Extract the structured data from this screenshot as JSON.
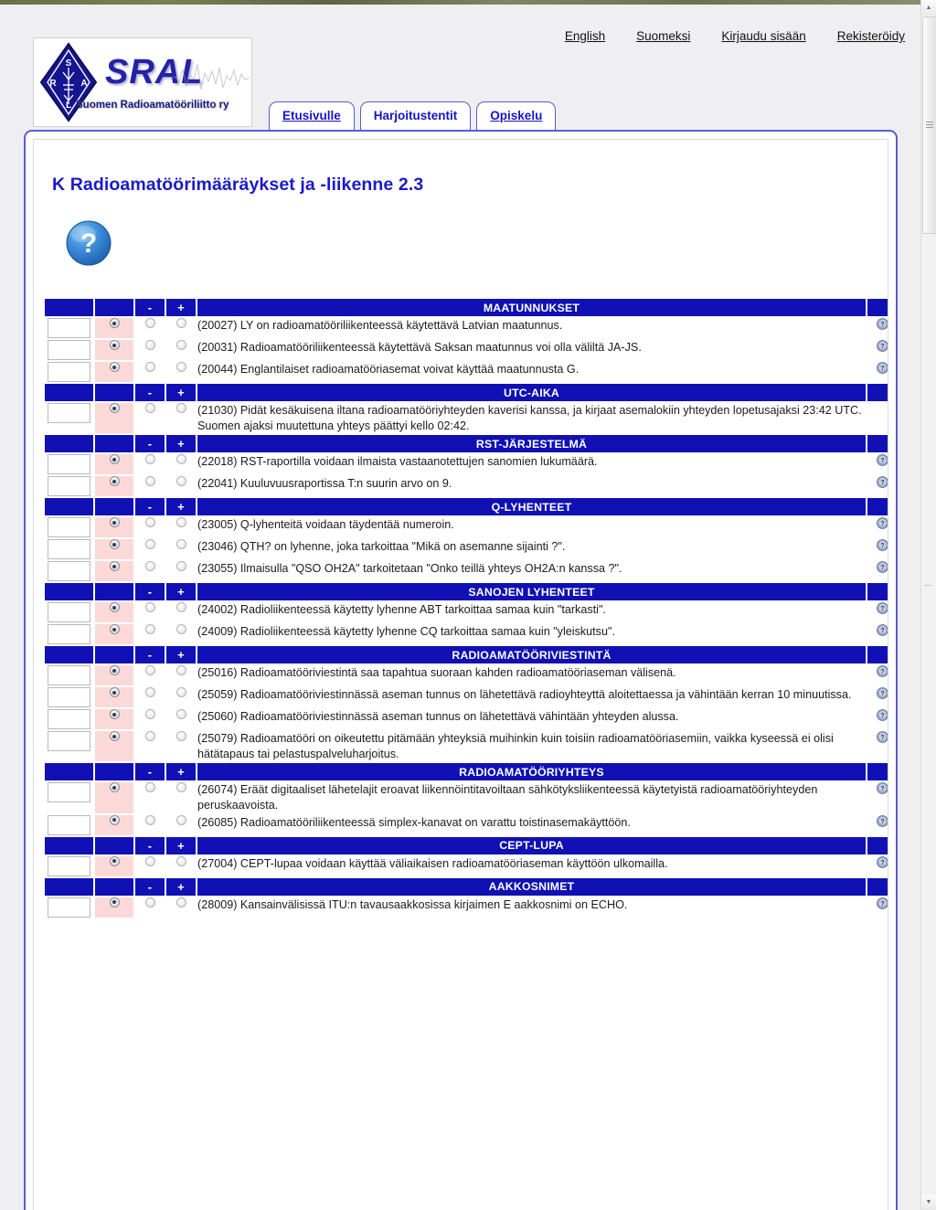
{
  "top_nav": {
    "links": [
      {
        "label": "English",
        "name": "nav-link-english"
      },
      {
        "label": "Suomeksi",
        "name": "nav-link-suomeksi"
      },
      {
        "label": "Kirjaudu sisään",
        "name": "nav-link-login"
      },
      {
        "label": "Rekisteröidy",
        "name": "nav-link-register"
      }
    ]
  },
  "logo": {
    "lettermark": "SRAL",
    "subtitle": "Suomen Radioamatööriliitto ry",
    "diamond_letters": [
      "S",
      "R",
      "A",
      "L"
    ],
    "colors": {
      "mark": "#2222aa",
      "diamond": "#15158f"
    }
  },
  "tabs": [
    {
      "label": "Etusivulle",
      "active": false
    },
    {
      "label": "Harjoitustentit",
      "active": true
    },
    {
      "label": "Opiskelu",
      "active": false
    }
  ],
  "page": {
    "title": "K Radioamatöörimääräykset ja -liikenne 2.3",
    "help_icon": "question-mark-icon"
  },
  "table": {
    "header_minus": "-",
    "header_plus": "+",
    "row_help_icon": "question-mark-icon",
    "colors": {
      "header_bg": "#1010b4",
      "selected_cell_bg": "#fbd9d9",
      "title_blue": "#1a1aca"
    },
    "sections": [
      {
        "title": "MAATUNNUKSET",
        "questions": [
          {
            "id": "20027",
            "text": "(20027) LY on radioamatööriliikenteessä käytettävä Latvian maatunnus.",
            "selected": "blank",
            "answer_value": ""
          },
          {
            "id": "20031",
            "text": "(20031) Radioamatööriliikenteessä käytettävä Saksan maatunnus voi olla väliltä JA-JS.",
            "selected": "blank",
            "answer_value": ""
          },
          {
            "id": "20044",
            "text": "(20044) Englantilaiset radioamatööriasemat voivat käyttää maatunnusta G.",
            "selected": "blank",
            "answer_value": ""
          }
        ]
      },
      {
        "title": "UTC-AIKA",
        "questions": [
          {
            "id": "21030",
            "text": "(21030) Pidät kesäkuisena iltana radioamatööriyhteyden kaverisi kanssa, ja kirjaat asemalokiin yhteyden lopetusajaksi 23:42 UTC. Suomen ajaksi muutettuna yhteys päättyi kello 02:42.",
            "selected": "blank",
            "answer_value": "",
            "show_help": false
          }
        ]
      },
      {
        "title": "RST-JÄRJESTELMÄ",
        "questions": [
          {
            "id": "22018",
            "text": "(22018) RST-raportilla voidaan ilmaista vastaanotettujen sanomien lukumäärä.",
            "selected": "blank",
            "answer_value": ""
          },
          {
            "id": "22041",
            "text": "(22041) Kuuluvuusraportissa T:n suurin arvo on 9.",
            "selected": "blank",
            "answer_value": ""
          }
        ]
      },
      {
        "title": "Q-LYHENTEET",
        "questions": [
          {
            "id": "23005",
            "text": "(23005) Q-lyhenteitä voidaan täydentää numeroin.",
            "selected": "blank",
            "answer_value": ""
          },
          {
            "id": "23046",
            "text": "(23046) QTH? on lyhenne, joka tarkoittaa \"Mikä on asemanne sijainti ?\".",
            "selected": "blank",
            "answer_value": ""
          },
          {
            "id": "23055",
            "text": "(23055) Ilmaisulla \"QSO OH2A\" tarkoitetaan \"Onko teillä yhteys OH2A:n kanssa ?\".",
            "selected": "blank",
            "answer_value": ""
          }
        ]
      },
      {
        "title": "SANOJEN LYHENTEET",
        "questions": [
          {
            "id": "24002",
            "text": "(24002) Radioliikenteessä käytetty lyhenne ABT tarkoittaa samaa kuin \"tarkasti\".",
            "selected": "blank",
            "answer_value": ""
          },
          {
            "id": "24009",
            "text": "(24009) Radioliikenteessä käytetty lyhenne CQ tarkoittaa samaa kuin \"yleiskutsu\".",
            "selected": "blank",
            "answer_value": ""
          }
        ]
      },
      {
        "title": "RADIOAMATÖÖRIVIESTINTÄ",
        "questions": [
          {
            "id": "25016",
            "text": "(25016) Radioamatööriviestintä saa tapahtua suoraan kahden radioamatööriaseman välisenä.",
            "selected": "blank",
            "answer_value": ""
          },
          {
            "id": "25059",
            "text": "(25059) Radioamatööriviestinnässä aseman tunnus on lähetettävä radioyhteyttä aloitettaessa ja vähintään kerran 10 minuutissa.",
            "selected": "blank",
            "answer_value": ""
          },
          {
            "id": "25060",
            "text": "(25060) Radioamatööriviestinnässä aseman tunnus on lähetettävä vähintään yhteyden alussa.",
            "selected": "blank",
            "answer_value": ""
          },
          {
            "id": "25079",
            "text": "(25079) Radioamatööri on oikeutettu pitämään yhteyksiä muihinkin kuin toisiin radioamatööriasemiin, vaikka kyseessä ei olisi hätätapaus tai pelastuspalveluharjoitus.",
            "selected": "blank",
            "answer_value": ""
          }
        ]
      },
      {
        "title": "RADIOAMATÖÖRIYHTEYS",
        "questions": [
          {
            "id": "26074",
            "text": "(26074) Eräät digitaaliset lähetelajit eroavat liikennöintitavoiltaan sähkötyksliikenteessä käytetyistä radioamatööriyhteyden peruskaavoista.",
            "selected": "blank",
            "answer_value": ""
          },
          {
            "id": "26085",
            "text": "(26085) Radioamatööriliikenteessä simplex-kanavat on varattu toistinasemakäyttöön.",
            "selected": "blank",
            "answer_value": ""
          }
        ]
      },
      {
        "title": "CEPT-LUPA",
        "questions": [
          {
            "id": "27004",
            "text": "(27004) CEPT-lupaa voidaan käyttää väliaikaisen radioamatööriaseman käyttöön ulkomailla.",
            "selected": "blank",
            "answer_value": ""
          }
        ]
      },
      {
        "title": "AAKKOSNIMET",
        "questions": [
          {
            "id": "28009",
            "text": "(28009) Kansainvälisissä ITU:n tavausaakkosissa kirjaimen E aakkosnimi on ECHO.",
            "selected": "blank",
            "answer_value": ""
          }
        ]
      }
    ]
  },
  "scrollbar": {
    "up_arrow": "caret-up-icon",
    "down_arrow": "caret-down-icon"
  }
}
